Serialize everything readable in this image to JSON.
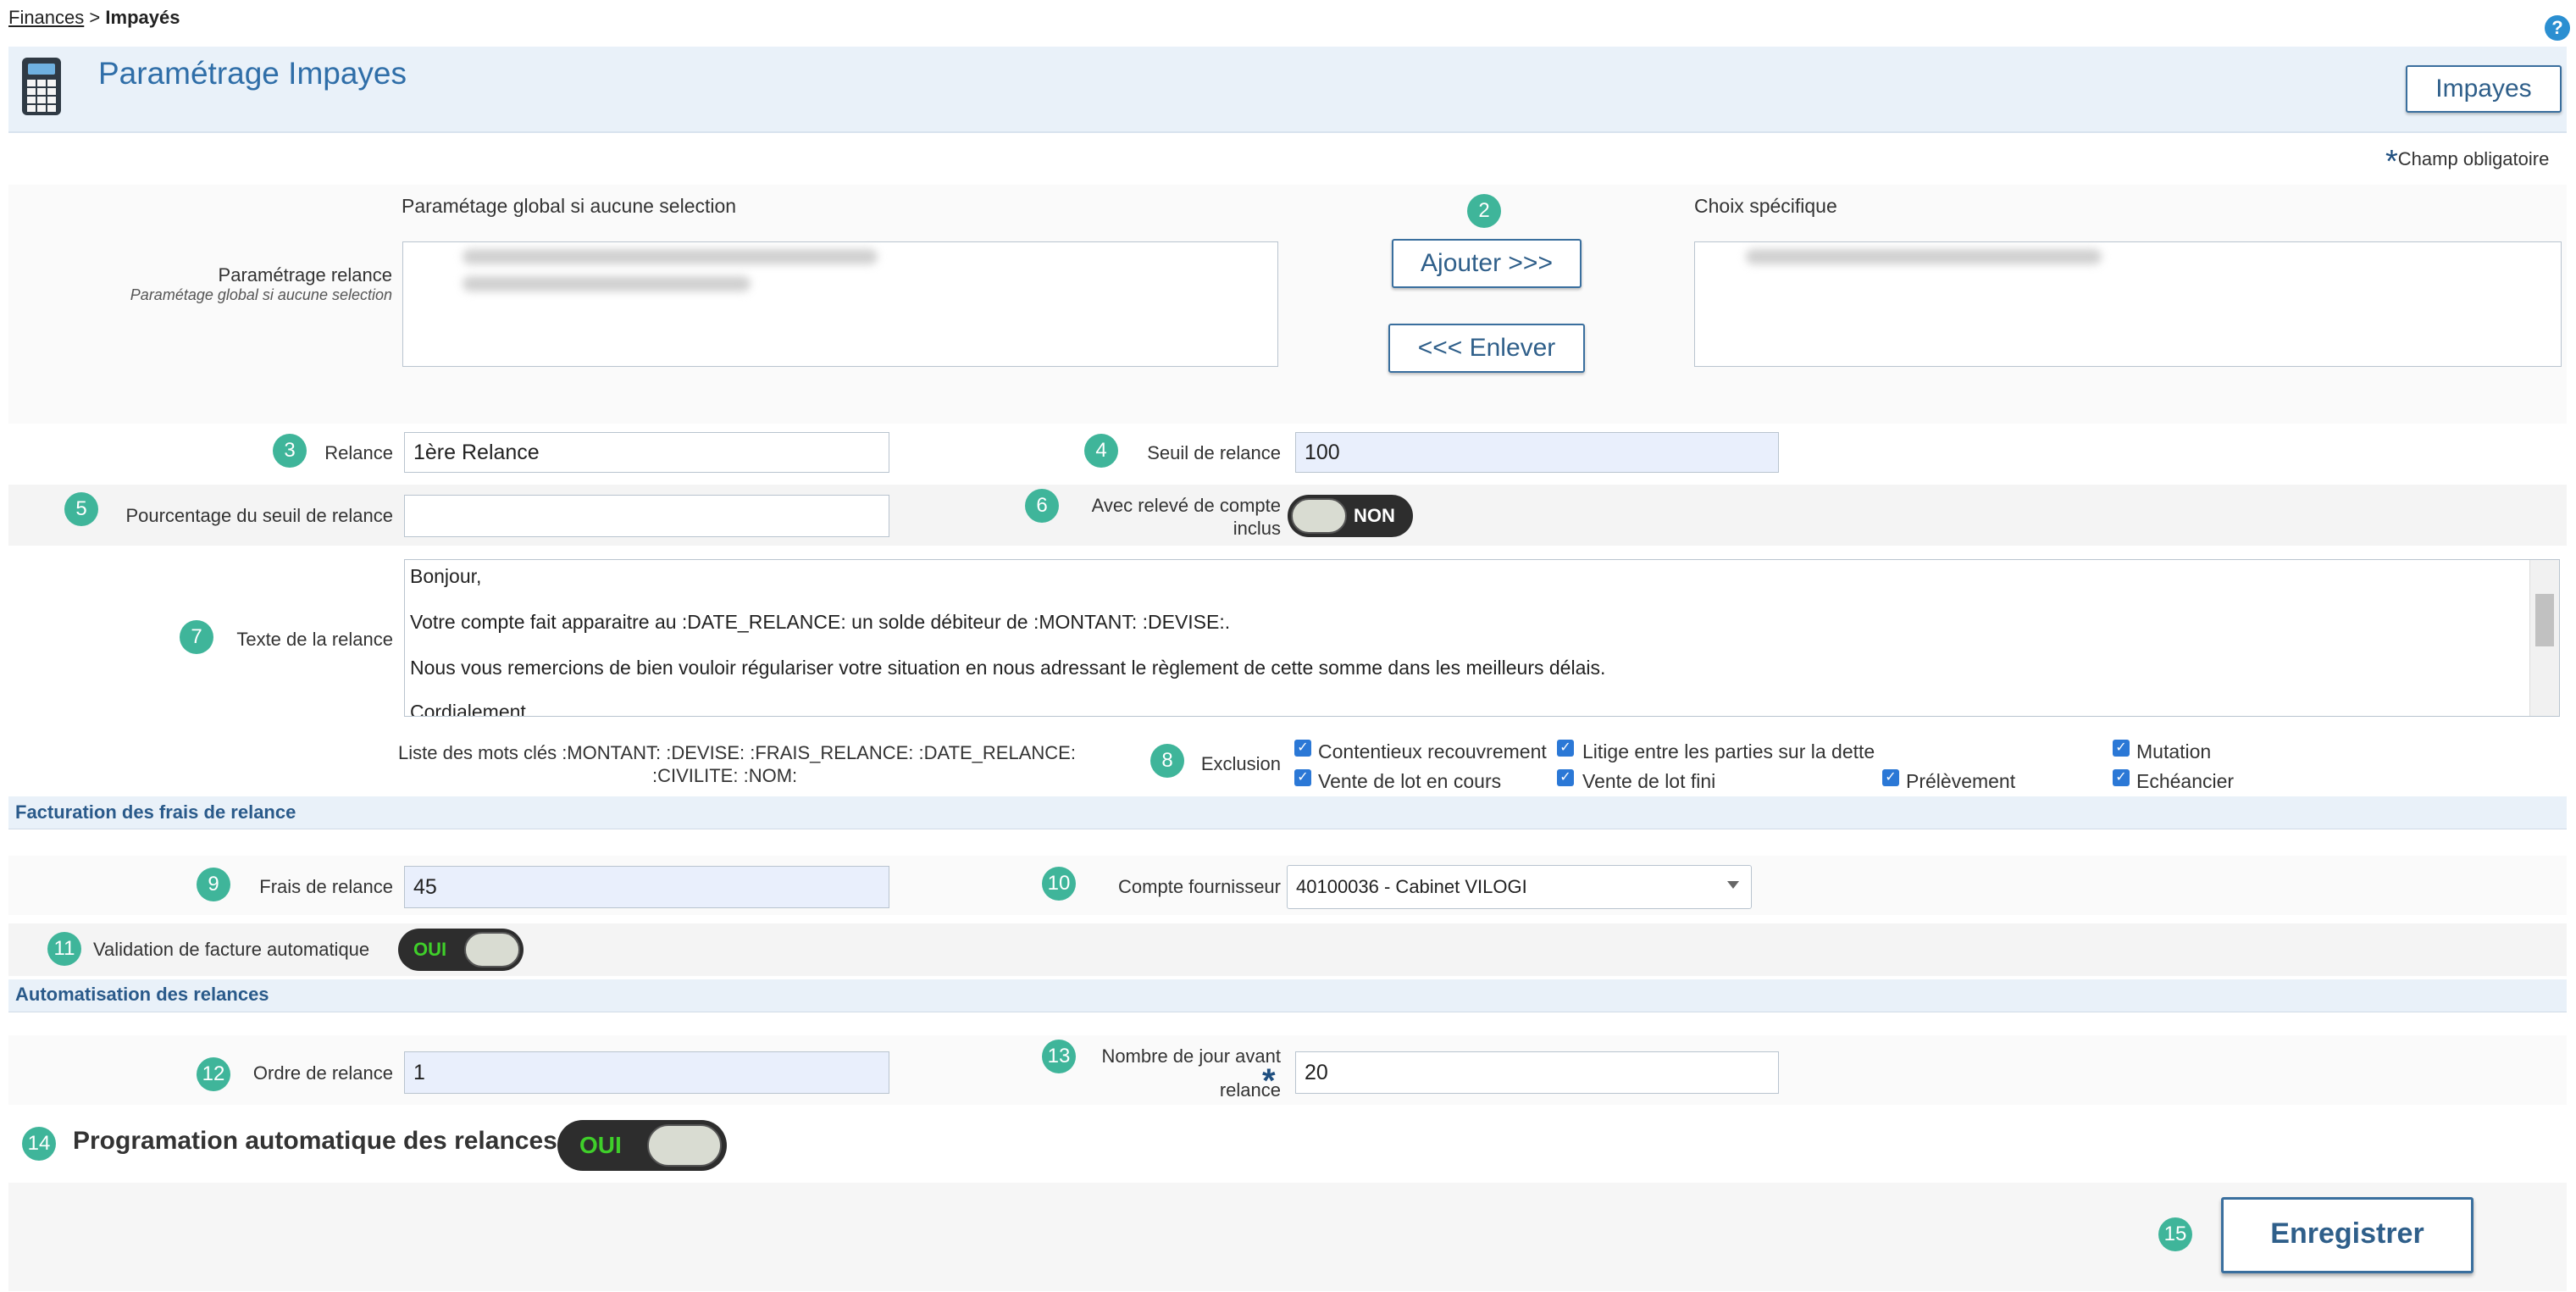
{
  "breadcrumb": {
    "parent": "Finances",
    "separator": ">",
    "current": "Impayés"
  },
  "header": {
    "title": "Paramétrage Impayes",
    "button_label": "Impayes",
    "help": "?"
  },
  "required_note": {
    "star": "*",
    "text": "Champ obligatoire"
  },
  "relance_selection": {
    "global_heading": "Paramétage global si aucune selection",
    "label": "Paramétrage relance",
    "sublabel": "Paramétage global si aucune selection",
    "add_button": "Ajouter >>>",
    "remove_button": "<<< Enlever",
    "specific_heading": "Choix spécifique"
  },
  "badges": [
    "2",
    "3",
    "4",
    "5",
    "6",
    "7",
    "8",
    "9",
    "10",
    "11",
    "12",
    "13",
    "14",
    "15"
  ],
  "fields": {
    "relance": {
      "label": "Relance",
      "value": "1ère Relance"
    },
    "seuil": {
      "label": "Seuil de relance",
      "value": "100"
    },
    "pourcentage": {
      "label": "Pourcentage du seuil de relance",
      "value": ""
    },
    "releve": {
      "label_line1": "Avec relevé de compte",
      "label_line2": "inclus",
      "toggle": "NON"
    },
    "texte": {
      "label": "Texte de la relance",
      "lines": [
        "Bonjour,",
        "Votre compte fait apparaitre au :DATE_RELANCE: un solde débiteur de :MONTANT: :DEVISE:.",
        "Nous vous remercions de bien vouloir régulariser votre situation en nous adressant le règlement de cette somme dans les meilleurs délais.",
        "Cordialement"
      ]
    },
    "keywords_line1": "Liste des mots clés :MONTANT: :DEVISE: :FRAIS_RELANCE: :DATE_RELANCE:",
    "keywords_line2": ":CIVILITE: :NOM:",
    "exclusion": {
      "label": "Exclusion",
      "options": [
        "Contentieux recouvrement",
        "Litige entre les parties sur la dette",
        "Mutation",
        "Vente de lot en cours",
        "Vente de lot fini",
        "Prélèvement",
        "Echéancier"
      ]
    }
  },
  "facturation": {
    "title": "Facturation des frais de relance",
    "frais_label": "Frais de relance",
    "frais_value": "45",
    "compte_label": "Compte fournisseur",
    "compte_value": "40100036 - Cabinet VILOGI",
    "validation_label": "Validation de facture automatique",
    "validation_toggle": "OUI"
  },
  "automatisation": {
    "title": "Automatisation des relances",
    "ordre_label": "Ordre de relance",
    "ordre_value": "1",
    "jours_label_line1": "Nombre de jour avant",
    "jours_label_line2": "relance",
    "jours_star": "*",
    "jours_value": "20",
    "programmation_label": "Programation automatique des relances",
    "programmation_toggle": "OUI"
  },
  "save_button": "Enregistrer",
  "colors": {
    "accent": "#2f6ea8",
    "badge": "#3fb59a",
    "toggle_on_text": "#3fcf2a",
    "checkbox": "#2b78d6"
  }
}
